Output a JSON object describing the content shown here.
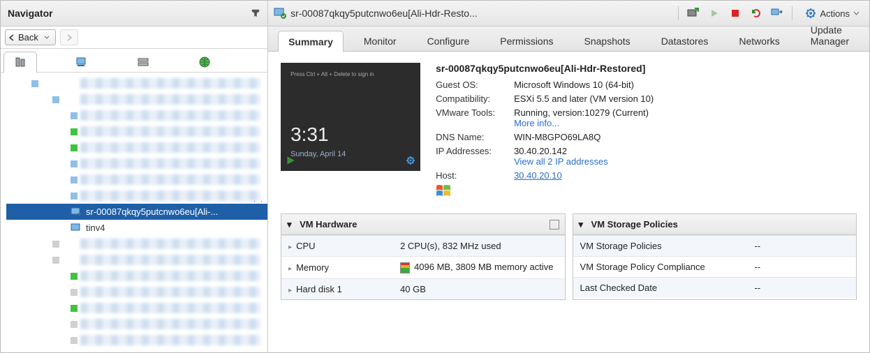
{
  "navigator": {
    "title": "Navigator",
    "back_label": "Back",
    "selected_item": "sr-00087qkqy5putcnwo6eu[Ali-...",
    "child_item": "tinv4"
  },
  "pane": {
    "breadcrumb": "sr-00087qkqy5putcnwo6eu[Ali-Hdr-Resto...",
    "actions_label": "Actions"
  },
  "tabs": {
    "summary": "Summary",
    "monitor": "Monitor",
    "configure": "Configure",
    "permissions": "Permissions",
    "snapshots": "Snapshots",
    "datastores": "Datastores",
    "networks": "Networks",
    "update_manager": "Update Manager"
  },
  "console": {
    "hint": "Press Ctrl + Alt + Delete to sign in",
    "clock": "3:31",
    "date": "Sunday, April 14"
  },
  "vm": {
    "title": "sr-00087qkqy5putcnwo6eu[Ali-Hdr-Restored]",
    "labels": {
      "guest_os": "Guest OS:",
      "compat": "Compatibility:",
      "tools": "VMware Tools:",
      "dns": "DNS Name:",
      "ip": "IP Addresses:",
      "host": "Host:"
    },
    "values": {
      "guest_os": "Microsoft Windows 10 (64-bit)",
      "compat": "ESXi 5.5 and later (VM version 10)",
      "tools": "Running, version:10279 (Current)",
      "tools_link": "More info...",
      "dns": "WIN-M8GPO69LA8Q",
      "ip": "30.40.20.142",
      "ip_link": "View all 2 IP addresses",
      "host": "30.40.20.10"
    }
  },
  "hw_panel": {
    "title": "VM Hardware",
    "rows": {
      "cpu_k": "CPU",
      "cpu_v": "2 CPU(s), 832 MHz used",
      "mem_k": "Memory",
      "mem_v": "4096 MB, 3809 MB memory active",
      "hd_k": "Hard disk 1",
      "hd_v": "40 GB"
    }
  },
  "sp_panel": {
    "title": "VM Storage Policies",
    "rows": {
      "pol_k": "VM Storage Policies",
      "pol_v": "--",
      "comp_k": "VM Storage Policy Compliance",
      "comp_v": "--",
      "date_k": "Last Checked Date",
      "date_v": "--"
    }
  }
}
